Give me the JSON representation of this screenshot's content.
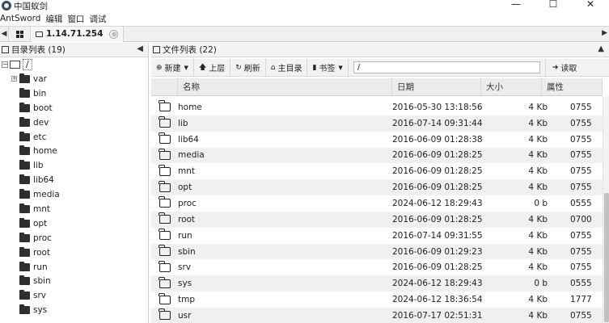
{
  "window": {
    "title": "中国蚁剑",
    "icon": "antsword-icon"
  },
  "window_buttons": {
    "minimize": "—",
    "maximize": "☐",
    "close": "✕"
  },
  "menu": {
    "items": [
      "AntSword",
      "编辑",
      "窗口",
      "调试"
    ]
  },
  "tabs": {
    "host_label": "1.14.71.254",
    "close_symbol": "⊗"
  },
  "left_panel": {
    "title": "目录列表 (19)",
    "root_label": "/",
    "items": [
      "var",
      "bin",
      "boot",
      "dev",
      "etc",
      "home",
      "lib",
      "lib64",
      "media",
      "mnt",
      "opt",
      "proc",
      "root",
      "run",
      "sbin",
      "srv",
      "sys"
    ]
  },
  "right_panel": {
    "title": "文件列表 (22)",
    "toolbar": {
      "new_label": "新建",
      "up_label": "上层",
      "refresh_label": "刷新",
      "home_label": "主目录",
      "bookmark_label": "书签",
      "path_value": "/",
      "read_label": "读取"
    },
    "columns": [
      "名称",
      "日期",
      "大小",
      "属性"
    ],
    "files": [
      {
        "name": "home",
        "date": "2016-05-30 13:18:56",
        "size": "4 Kb",
        "attr": "0755"
      },
      {
        "name": "lib",
        "date": "2016-07-14 09:31:44",
        "size": "4 Kb",
        "attr": "0755"
      },
      {
        "name": "lib64",
        "date": "2016-06-09 01:28:38",
        "size": "4 Kb",
        "attr": "0755"
      },
      {
        "name": "media",
        "date": "2016-06-09 01:28:25",
        "size": "4 Kb",
        "attr": "0755"
      },
      {
        "name": "mnt",
        "date": "2016-06-09 01:28:25",
        "size": "4 Kb",
        "attr": "0755"
      },
      {
        "name": "opt",
        "date": "2016-06-09 01:28:25",
        "size": "4 Kb",
        "attr": "0755"
      },
      {
        "name": "proc",
        "date": "2024-06-12 18:29:43",
        "size": "0 b",
        "attr": "0555"
      },
      {
        "name": "root",
        "date": "2016-06-09 01:28:25",
        "size": "4 Kb",
        "attr": "0700"
      },
      {
        "name": "run",
        "date": "2016-07-14 09:31:55",
        "size": "4 Kb",
        "attr": "0755"
      },
      {
        "name": "sbin",
        "date": "2016-06-09 01:29:23",
        "size": "4 Kb",
        "attr": "0755"
      },
      {
        "name": "srv",
        "date": "2016-06-09 01:28:25",
        "size": "4 Kb",
        "attr": "0755"
      },
      {
        "name": "sys",
        "date": "2024-06-12 18:29:43",
        "size": "0 b",
        "attr": "0555"
      },
      {
        "name": "tmp",
        "date": "2024-06-12 18:36:54",
        "size": "4 Kb",
        "attr": "1777"
      },
      {
        "name": "usr",
        "date": "2016-07-17 02:51:31",
        "size": "4 Kb",
        "attr": "0755"
      }
    ]
  }
}
